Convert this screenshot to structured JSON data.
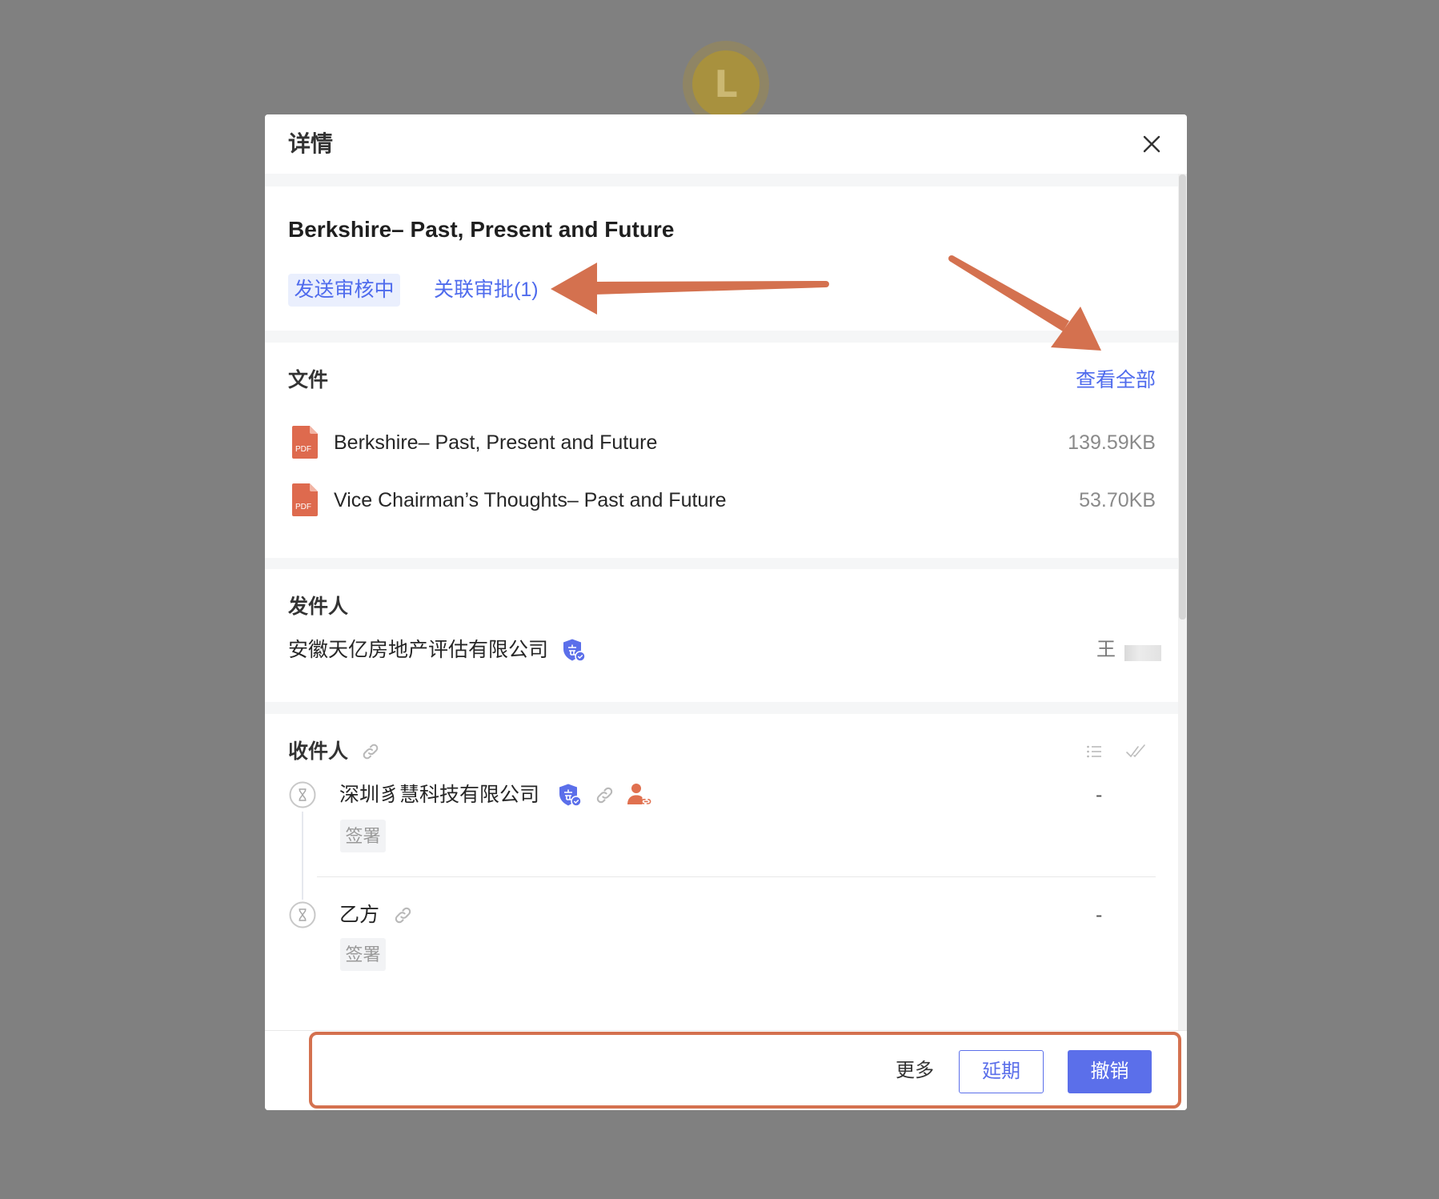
{
  "avatar": {
    "letter": "L"
  },
  "modal": {
    "title": "详情",
    "close_icon": "close-icon"
  },
  "document": {
    "title": "Berkshire– Past, Present and Future",
    "status_tag": "发送审核中",
    "related_link": "关联审批(1)"
  },
  "files": {
    "heading": "文件",
    "view_all": "查看全部",
    "items": [
      {
        "name": "Berkshire– Past, Present and Future",
        "size": "139.59KB",
        "icon": "pdf-icon",
        "badge": "PDF"
      },
      {
        "name": "Vice Chairman’s Thoughts– Past and Future",
        "size": "53.70KB",
        "icon": "pdf-icon",
        "badge": "PDF"
      }
    ]
  },
  "sender": {
    "heading": "发件人",
    "company": "安徽天亿房地产评估有限公司",
    "company_icon": "enterprise-verified-icon",
    "person": "王"
  },
  "recipients": {
    "heading": "收件人",
    "heading_icon": "link-icon",
    "toolbar_icons": [
      "list-icon",
      "double-check-icon"
    ],
    "items": [
      {
        "name": "深圳豸慧科技有限公司",
        "action": "签署",
        "status": "-",
        "state_icon": "hourglass-icon",
        "badges": [
          "enterprise-verified-icon",
          "link-icon",
          "person-link-icon"
        ]
      },
      {
        "name": "乙方",
        "action": "签署",
        "status": "-",
        "state_icon": "hourglass-icon",
        "badges": [
          "link-icon"
        ]
      }
    ]
  },
  "footer": {
    "more": "更多",
    "extend": "延期",
    "revoke": "撤销"
  },
  "colors": {
    "primary": "#5b6fea",
    "link": "#4f6bed",
    "tag_bg": "#eaeffd",
    "annotation": "#d4714f",
    "pdf": "#de6a4e",
    "person_icon": "#e0704f",
    "band": "#f5f6f7",
    "overlay": "#808080",
    "avatar_gold": "#a8913e"
  }
}
